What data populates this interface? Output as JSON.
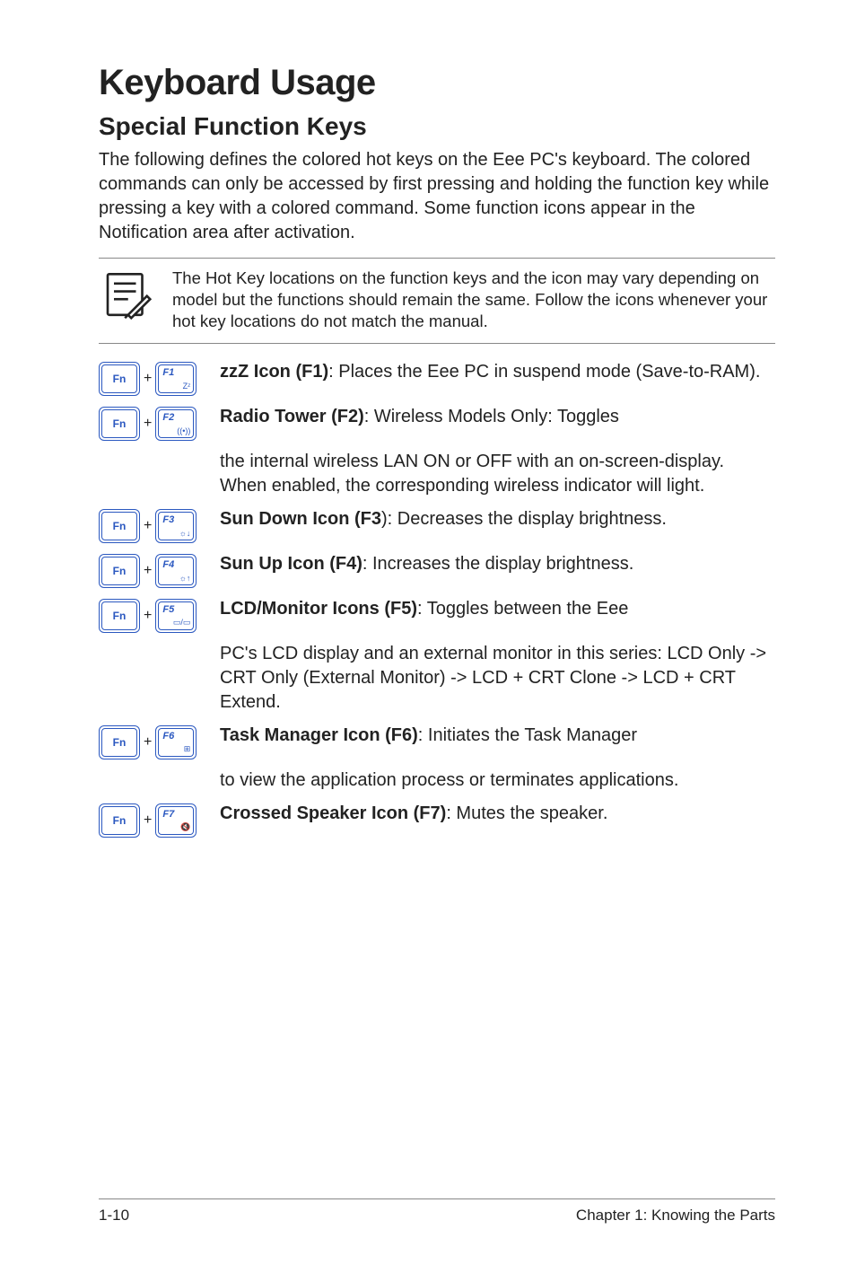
{
  "heading": "Keyboard Usage",
  "subheading": "Special Function Keys",
  "intro": "The following defines the colored hot keys on the Eee PC's keyboard. The colored commands can only be accessed by first pressing and holding the function key while pressing a key with a colored command. Some function icons appear in the Notification area after activation.",
  "note": "The Hot Key locations on the function keys and the icon may vary depending on model but the functions should remain the same. Follow the icons whenever your hot key locations do not match the manual.",
  "plus": "+",
  "rows": [
    {
      "flabel": "F1",
      "fsub": "Zᶻ",
      "title": "zzZ Icon (F1)",
      "rest": ": Places the Eee PC in suspend mode (Save-to-RAM)."
    },
    {
      "flabel": "F2",
      "fsub": "((•))",
      "title": "Radio Tower (F2)",
      "rest": ": Wireless Models Only: Toggles",
      "cont": "the internal wireless LAN ON or OFF with an on-screen-display. When enabled, the corresponding wireless indicator will light."
    },
    {
      "flabel": "F3",
      "fsub": "☼↓",
      "title": "Sun Down Icon (F3",
      "rest": "): Decreases the display brightness."
    },
    {
      "flabel": "F4",
      "fsub": "☼↑",
      "title": "Sun Up Icon (F4)",
      "rest": ": Increases the display brightness."
    },
    {
      "flabel": "F5",
      "fsub": "▭/▭",
      "title": "LCD/Monitor Icons (F5)",
      "rest": ": Toggles between the Eee",
      "cont": "PC's LCD display and an external monitor in this series: LCD Only -> CRT Only (External Monitor) -> LCD + CRT Clone -> LCD + CRT Extend."
    },
    {
      "flabel": "F6",
      "fsub": "⊞",
      "title": "Task Manager Icon (F6)",
      "rest": ": Initiates the Task Manager",
      "cont": "to view the application process or terminates applications."
    },
    {
      "flabel": "F7",
      "fsub": "🔇",
      "title": "Crossed Speaker Icon (F7)",
      "rest": ": Mutes the speaker."
    }
  ],
  "footer": {
    "page": "1-10",
    "chapter": "Chapter 1: Knowing the Parts"
  }
}
